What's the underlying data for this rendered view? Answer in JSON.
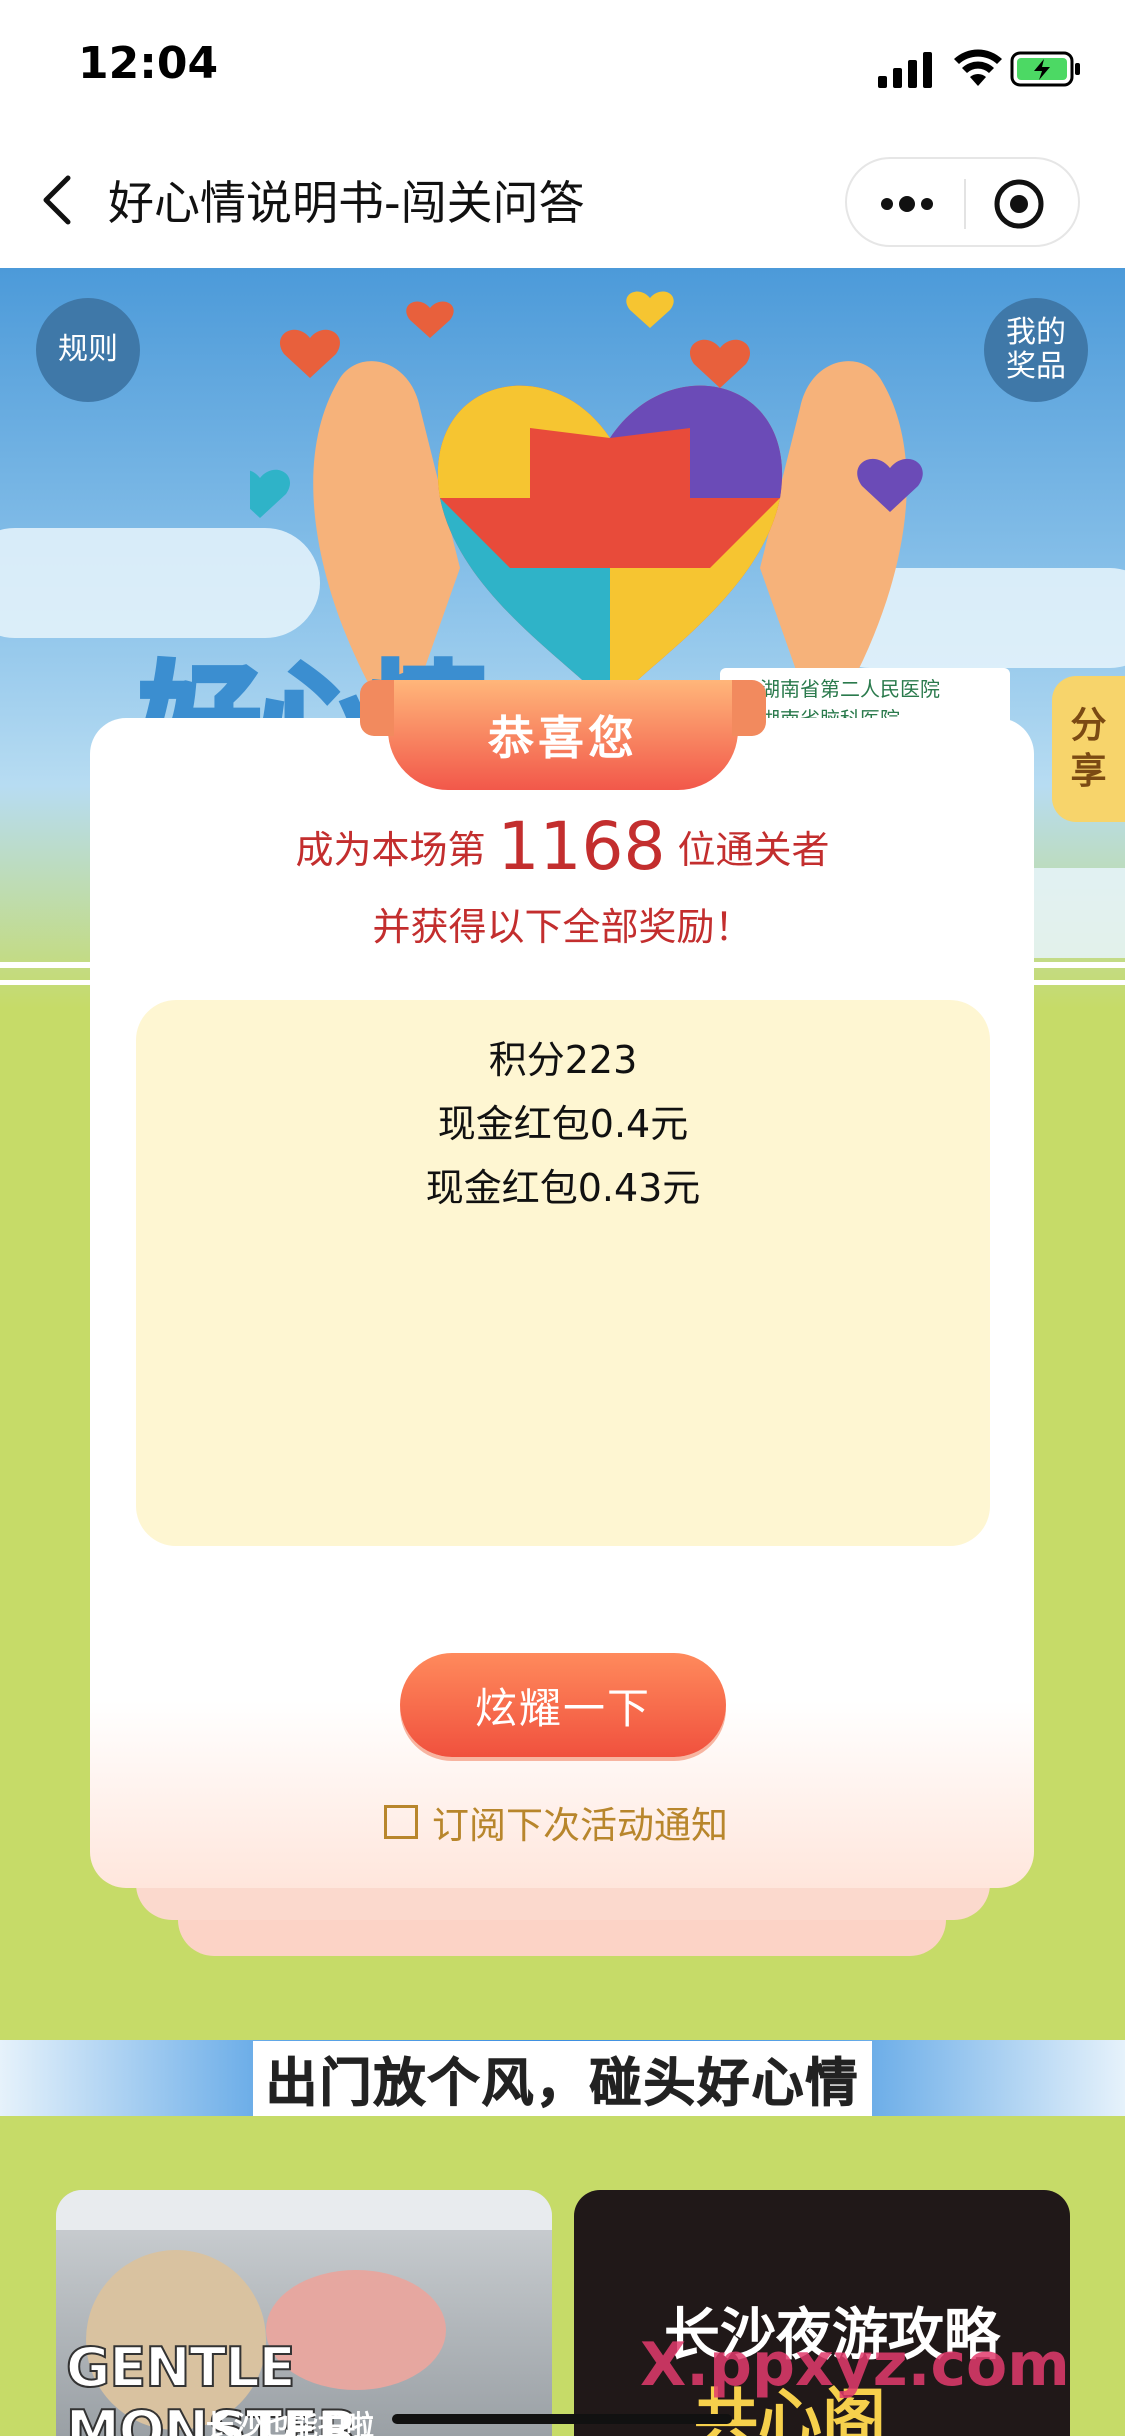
{
  "status_bar": {
    "time": "12:04"
  },
  "nav": {
    "title": "好心情说明书-闯关问答"
  },
  "hero": {
    "rules_label": "规则",
    "my_prize_label": "我的\n奖品",
    "share_label": "分\n享",
    "hospital_line1": "湖南省第二人民医院",
    "hospital_line2": "湖南省脑科医院"
  },
  "card": {
    "ribbon": "恭喜您",
    "line1_prefix": "成为本场第",
    "rank": "1168",
    "line1_suffix": "位通关者",
    "line2": "并获得以下全部奖励！",
    "rewards": [
      "积分223",
      "现金红包0.4元",
      "现金红包0.43元"
    ],
    "show_button": "炫耀一下",
    "subscribe_label": "订阅下次活动通知"
  },
  "band": {
    "slogan": "出门放个风，碰头好心情"
  },
  "tiles": [
    {
      "title": "GENTLE MONSTER",
      "subtitle": "长沙也能拍啦"
    },
    {
      "title": "长沙夜游攻略",
      "subtitle": "共心阁"
    }
  ],
  "watermark": "X.ppxyz.com",
  "colors": {
    "accent_red": "#c32e2e",
    "button": "#f0513e",
    "gold": "#b8862c",
    "bg_green": "#c6db68"
  }
}
